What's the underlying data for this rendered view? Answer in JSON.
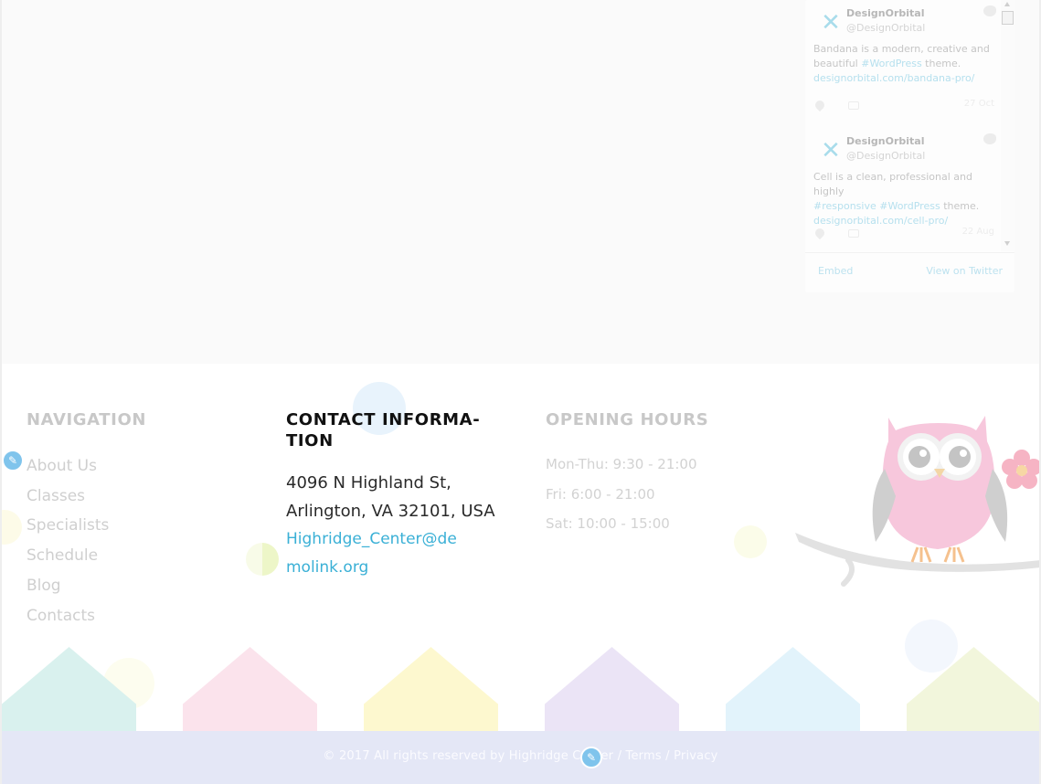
{
  "twitter_widget": {
    "tweets": [
      {
        "name": "DesignOrbital",
        "handle": "@DesignOrbital",
        "text_before": "Bandana is a modern, creative and beautiful ",
        "hashtag1": "#WordPress",
        "text_after": " theme.",
        "link": "designorbital.com/bandana-pro/",
        "date": "27 Oct"
      },
      {
        "name": "DesignOrbital",
        "handle": "@DesignOrbital",
        "text_before": "Cell is a clean, professional and highly ",
        "hashtag1": "#responsive",
        "hashtag2": "#WordPress",
        "text_after": " theme.",
        "link": "designorbital.com/cell-pro/",
        "date": "22 Aug"
      }
    ],
    "embed_label": "Embed",
    "view_label": "View on Twitter"
  },
  "footer": {
    "navigation": {
      "heading": "NAVIGATION",
      "items": [
        "About Us",
        "Classes",
        "Specialists",
        "Schedule",
        "Blog",
        "Contacts"
      ]
    },
    "contact": {
      "heading": "CONTACT INFORMA-TION",
      "address": "4096 N Highland St, Arlington, VA 32101, USA",
      "email": "Highridge_Center@demolink.org"
    },
    "hours": {
      "heading": "OPENING HOURS",
      "items": [
        "Mon-Thu: 9:30 - 21:00",
        "Fri: 6:00 - 21:00",
        "Sat: 10:00 - 15:00"
      ]
    }
  },
  "bottom_bar": {
    "copyright": "© 2017 All rights reserved by Highridge Center",
    "terms": "Terms",
    "privacy": "Privacy",
    "separator": "/"
  },
  "colors": {
    "bottom_bar_bg": "#e4e7f6",
    "link": "#3ab0d6",
    "house_teal": "#d9f1ee",
    "house_pink": "#fbe3ec",
    "house_yellow": "#fdf8cf",
    "house_lavender": "#ebe4f6",
    "house_blue": "#e2f3fb",
    "house_green": "#f2f6dc"
  }
}
